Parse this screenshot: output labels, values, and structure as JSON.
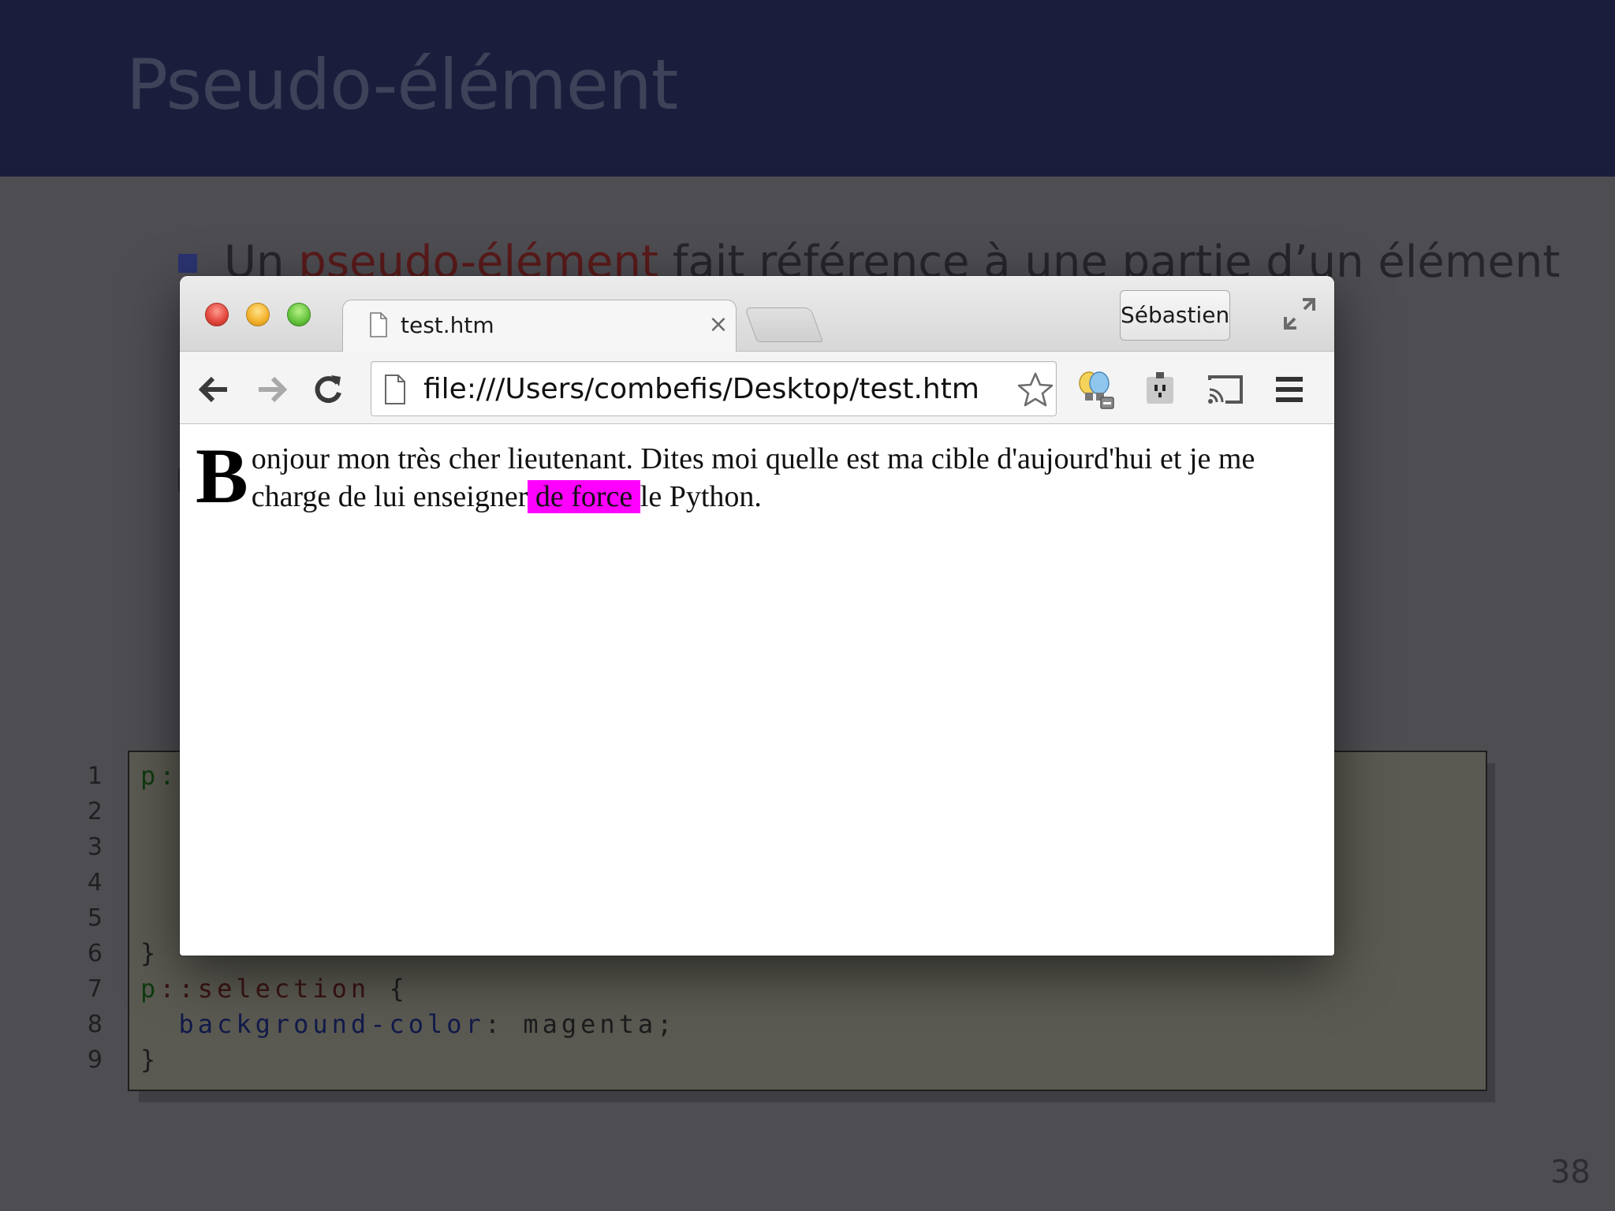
{
  "slide": {
    "title": "Pseudo-élément",
    "bullet_prefix": "Un ",
    "bullet_term": "pseudo-élément",
    "bullet_suffix": " fait référence à une partie d’un élément",
    "page_number": "38"
  },
  "code": {
    "line_numbers": [
      "1",
      "2",
      "3",
      "4",
      "5",
      "6",
      "7",
      "8",
      "9"
    ],
    "line1": "p:",
    "line6": "}",
    "line7_selector": "p",
    "line7_pseudo": "::selection",
    "line7_brace": " {",
    "line8_property": "background-color",
    "line8_value": ": magenta;",
    "line9": "}"
  },
  "browser": {
    "tab_title": "test.htm",
    "tab_close": "×",
    "profile_name": "Sébastien",
    "url": "file:///Users/combefis/Desktop/test.htm",
    "icons": [
      "back-arrow-icon",
      "forward-arrow-icon",
      "reload-icon",
      "page-icon",
      "star-icon",
      "lightbulb-extension-icon",
      "pocket-extension-icon",
      "cast-icon",
      "menu-icon",
      "fullscreen-icon"
    ],
    "content": {
      "drop_cap": "B",
      "text_before": "onjour mon très cher lieutenant. Dites moi quelle est ma cible d'aujourd'hui et je me charge de lui enseigner",
      "selected_text": " de force ",
      "text_after": "le Python."
    },
    "selection_color": "#ff00ff"
  }
}
